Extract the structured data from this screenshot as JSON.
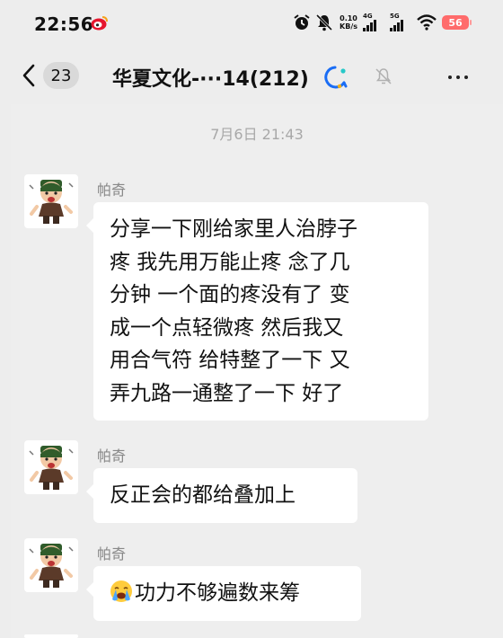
{
  "status": {
    "time": "22:56",
    "speed_value": "0.10",
    "speed_unit": "KB/s",
    "net1": "4G",
    "net2": "5G",
    "battery": "56"
  },
  "header": {
    "unread_count": "23",
    "title": "华夏文化-···14(212)"
  },
  "chat": {
    "timestamp": "7月6日 21:43",
    "messages": [
      {
        "sender": "帕奇",
        "lines": [
          "分享一下刚给家里人治脖子",
          "疼  我先用万能止疼 念了几",
          "分钟 一个面的疼没有了 变",
          "成一个点轻微疼 然后我又",
          "用合气符  给特整了一下 又",
          "弄九路一通整了一下  好了"
        ]
      },
      {
        "sender": "帕奇",
        "lines": [
          "反正会的都给叠加上"
        ]
      },
      {
        "sender": "帕奇",
        "emoji": "crying-face",
        "text": "功力不够遍数来筹"
      }
    ]
  },
  "colors": {
    "background": "#ededed",
    "bubble": "#ffffff",
    "battery": "#ff6b6b"
  }
}
